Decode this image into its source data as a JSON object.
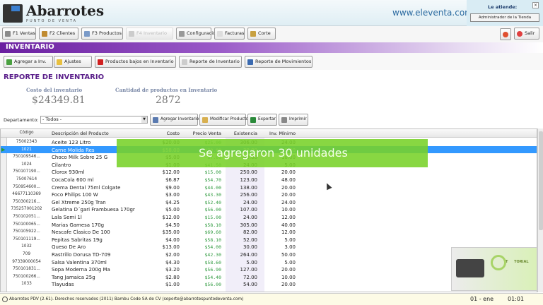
{
  "header": {
    "app_name": "Abarrotes",
    "app_subtitle": "PUNTO DE VENTA",
    "website": "www.eleventa.com",
    "attend_label": "Le atiende:",
    "attend_user": "Administrador de la Tienda"
  },
  "nav": [
    {
      "label": "F1 Ventas",
      "color": "#8a8a8a"
    },
    {
      "label": "F2 Clientes",
      "color": "#c08a30"
    },
    {
      "label": "F3 Productos",
      "color": "#7a9ac8"
    },
    {
      "label": "F4 Inventario",
      "color": "#cccccc",
      "disabled": true
    },
    {
      "label": "Configuración",
      "color": "#999999"
    },
    {
      "label": "Facturas",
      "color": "#dddddd"
    },
    {
      "label": "Corte",
      "color": "#c8a040"
    }
  ],
  "exit_label": "Salir",
  "section_title": "INVENTARIO",
  "actions": [
    {
      "label": "Agregar a Inv.",
      "color": "#4aa040"
    },
    {
      "label": "Ajustes",
      "color": "#e8c040"
    },
    {
      "label": "Productos bajos en Inventario",
      "color": "#d02020"
    },
    {
      "label": "Reporte de Inventario",
      "color": "#cccccc"
    },
    {
      "label": "Reporte de Movimientos",
      "color": "#3a6ab0"
    }
  ],
  "report": {
    "title": "REPORTE DE INVENTARIO",
    "cost_label": "Costo del inventario",
    "cost_value": "$24349.81",
    "qty_label": "Cantidad de productos en Inventario",
    "qty_value": "2872",
    "dept_label": "Departamento:",
    "dept_value": "- Todos -",
    "buttons": [
      "Agregar Inventario",
      "Modificar Producto",
      "Exportar",
      "Imprimir"
    ]
  },
  "table": {
    "columns": [
      "Código",
      "Descripción del Producto",
      "Costo",
      "Precio Venta",
      "Existencia",
      "Inv. Mínimo"
    ],
    "selected_index": 1,
    "rows": [
      [
        "75002343",
        "Aceite 123 Litro",
        "$20.00",
        "$25.00",
        "306.00",
        "24.00"
      ],
      [
        "1021",
        "Carne Molida Res",
        "$58.00",
        "$70.00",
        "30.00",
        "5.00"
      ],
      [
        "750109546...",
        "Choco Milk Sobre 25 G",
        "$5.00",
        "$7.00",
        "40.00",
        "10.00"
      ],
      [
        "1024",
        "Cilantro",
        "$1.00",
        "$41.50",
        "24.00",
        "5.00"
      ],
      [
        "750107190...",
        "Clorox 930ml",
        "$12.00",
        "$15.00",
        "250.00",
        "20.00"
      ],
      [
        "75007614",
        "CocaCola 600 ml",
        "$6.87",
        "$54.70",
        "123.00",
        "48.00"
      ],
      [
        "750954600...",
        "Crema Dental 75ml Colgate",
        "$9.00",
        "$44.00",
        "138.00",
        "20.00"
      ],
      [
        "46677110369",
        "Foco Philips 100 W",
        "$3.00",
        "$43.30",
        "256.00",
        "20.00"
      ],
      [
        "750300216...",
        "Gel Xtreme 250g Tran",
        "$4.25",
        "$52.40",
        "24.00",
        "24.00"
      ],
      [
        "735257001202",
        "Gelatina D´gari Frambuesa 170gr",
        "$5.00",
        "$56.00",
        "107.00",
        "10.00"
      ],
      [
        "750102051...",
        "Lala Semi 1l",
        "$12.00",
        "$15.00",
        "24.00",
        "12.00"
      ],
      [
        "750100065...",
        "Marias Gamesa 170g",
        "$4.50",
        "$58.10",
        "305.00",
        "40.00"
      ],
      [
        "750105922...",
        "Nescafe Clasico De 100",
        "$35.00",
        "$69.60",
        "82.00",
        "12.00"
      ],
      [
        "750101119...",
        "Pepitas Sabritas 19g",
        "$4.00",
        "$58.10",
        "52.00",
        "5.00"
      ],
      [
        "1032",
        "Queso De Aro",
        "$13.00",
        "$54.00",
        "30.00",
        "3.00"
      ],
      [
        "709",
        "Rastrillo Dorusa TD-709",
        "$2.00",
        "$42.30",
        "264.00",
        "50.00"
      ],
      [
        "97339000054",
        "Salsa Valentina 370ml",
        "$4.30",
        "$58.60",
        "5.00",
        "5.00"
      ],
      [
        "750101831...",
        "Sopa Moderna 200g Ma",
        "$3.20",
        "$56.90",
        "127.00",
        "20.00"
      ],
      [
        "750100266...",
        "Tang Jamaica 25g",
        "$2.80",
        "$54.40",
        "72.00",
        "10.00"
      ],
      [
        "1033",
        "Tlayudas",
        "$1.00",
        "$56.00",
        "54.00",
        "20.00"
      ]
    ]
  },
  "toast": "Se agregaron 30 unidades",
  "status": {
    "message": "Abarrotes PDV (2.61). Derechos reservados (2011) Bambu Code SA de CV (soporte@abarrotespuntodeventa.com)",
    "date": "01 - ene",
    "time": "01:01"
  },
  "watermark": {
    "text": "TORIAL"
  }
}
